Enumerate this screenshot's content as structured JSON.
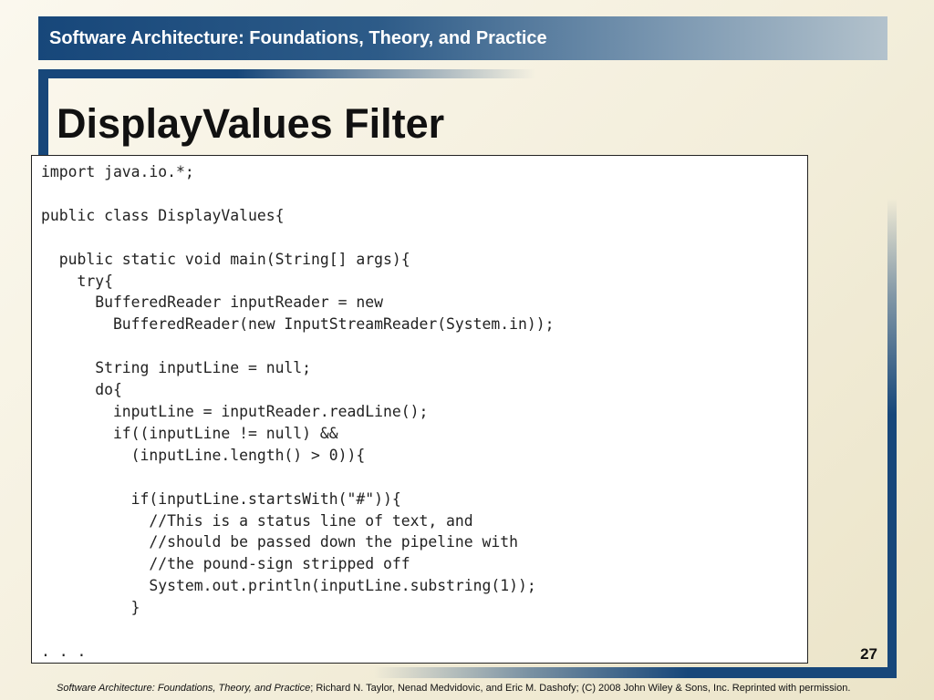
{
  "header": {
    "title": "Software Architecture: Foundations, Theory, and Practice"
  },
  "slide": {
    "title": "DisplayValues Filter",
    "code": "import java.io.*;\n\npublic class DisplayValues{\n\n  public static void main(String[] args){\n    try{\n      BufferedReader inputReader = new\n        BufferedReader(new InputStreamReader(System.in));\n\n      String inputLine = null;\n      do{\n        inputLine = inputReader.readLine();\n        if((inputLine != null) &&\n          (inputLine.length() > 0)){\n\n          if(inputLine.startsWith(\"#\")){\n            //This is a status line of text, and\n            //should be passed down the pipeline with\n            //the pound-sign stripped off\n            System.out.println(inputLine.substring(1));\n          }\n\n. . .",
    "page_number": "27"
  },
  "footer": {
    "book_title": "Software Architecture: Foundations, Theory, and Practice",
    "credits": "; Richard N. Taylor, Nenad Medvidovic, and Eric M. Dashofy; (C) 2008 John Wiley & Sons, Inc. Reprinted with permission."
  }
}
